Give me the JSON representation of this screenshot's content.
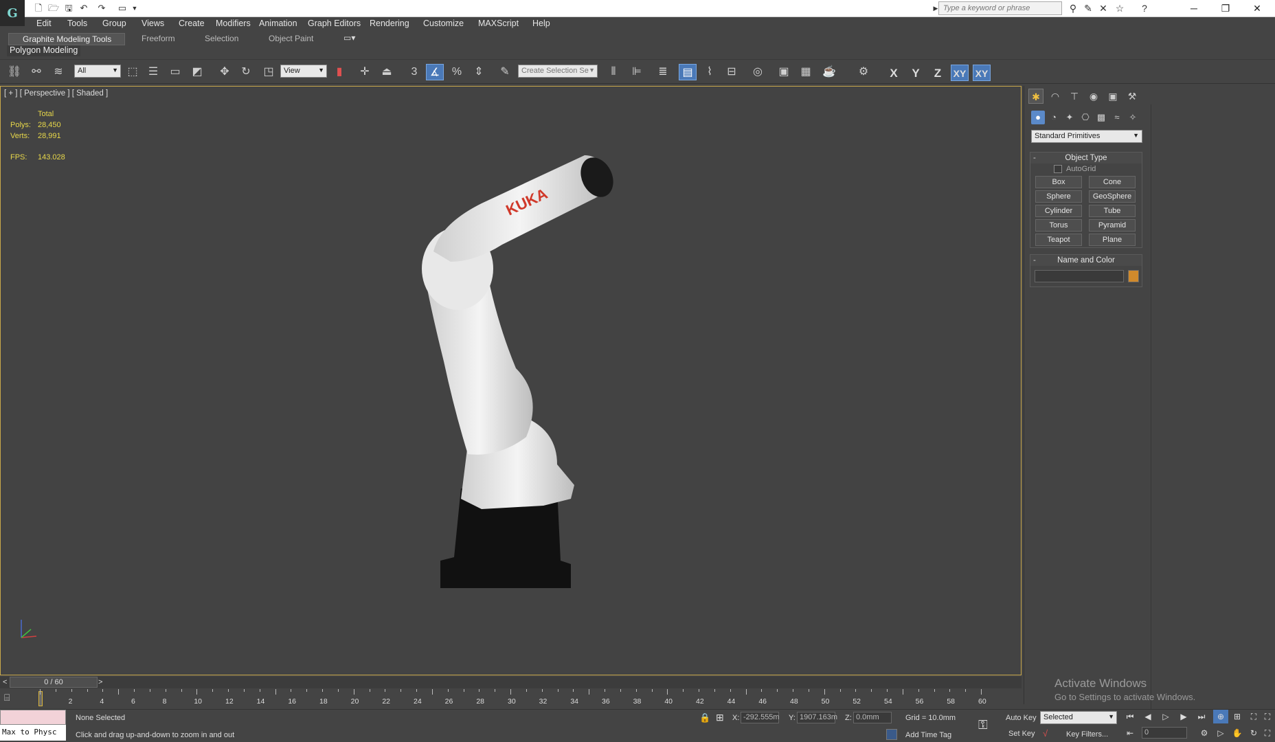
{
  "search": {
    "placeholder": "Type a keyword or phrase"
  },
  "menu": [
    "Edit",
    "Tools",
    "Group",
    "Views",
    "Create",
    "Modifiers",
    "Animation",
    "Graph Editors",
    "Rendering",
    "Customize",
    "MAXScript",
    "Help"
  ],
  "ribbon": {
    "tabs": [
      "Graphite Modeling Tools",
      "Freeform",
      "Selection",
      "Object Paint"
    ],
    "panel_label": "Polygon Modeling"
  },
  "toolbar": {
    "filter_value": "All",
    "ref_coord_value": "View",
    "selection_set_placeholder": "Create Selection Se",
    "snap_label": "3",
    "axes": [
      "X",
      "Y",
      "Z",
      "XY",
      "XY"
    ]
  },
  "viewport": {
    "label": "[ + ] [ Perspective ] [ Shaded ]",
    "stats": {
      "header": "Total",
      "polys_label": "Polys:",
      "polys": "28,450",
      "verts_label": "Verts:",
      "verts": "28,991",
      "fps_label": "FPS:",
      "fps": "143.028"
    },
    "model_brand": "KUKA"
  },
  "command_panel": {
    "dropdown": "Standard Primitives",
    "object_type": {
      "title": "Object Type",
      "autogrid": "AutoGrid",
      "buttons": [
        "Box",
        "Cone",
        "Sphere",
        "GeoSphere",
        "Cylinder",
        "Tube",
        "Torus",
        "Pyramid",
        "Teapot",
        "Plane"
      ]
    },
    "name_color": {
      "title": "Name and Color",
      "color": "#d08a2c"
    }
  },
  "timeline": {
    "frame": "0 / 60",
    "prev": "<",
    "next": ">",
    "ticks": [
      "2",
      "4",
      "6",
      "8",
      "10",
      "12",
      "14",
      "16",
      "18",
      "20",
      "22",
      "24",
      "26",
      "28",
      "30",
      "32",
      "34",
      "36",
      "38",
      "40",
      "42",
      "44",
      "46",
      "48",
      "50",
      "52",
      "54",
      "56",
      "58",
      "60"
    ]
  },
  "status": {
    "selection": "None Selected",
    "prompt": "Click and drag up-and-down to zoom in and out",
    "maxscript": "Max to Physc",
    "x_label": "X:",
    "x_value": "-292.555m",
    "y_label": "Y:",
    "y_value": "1907.163m",
    "z_label": "Z:",
    "z_value": "0.0mm",
    "grid": "Grid = 10.0mm",
    "add_time_tag": "Add Time Tag",
    "auto_key": "Auto Key",
    "set_key": "Set Key",
    "selected_dropdown": "Selected",
    "key_filters": "Key Filters...",
    "frame_input": "0"
  },
  "watermark": {
    "title": "Activate Windows",
    "subtitle": "Go to Settings to activate Windows."
  }
}
